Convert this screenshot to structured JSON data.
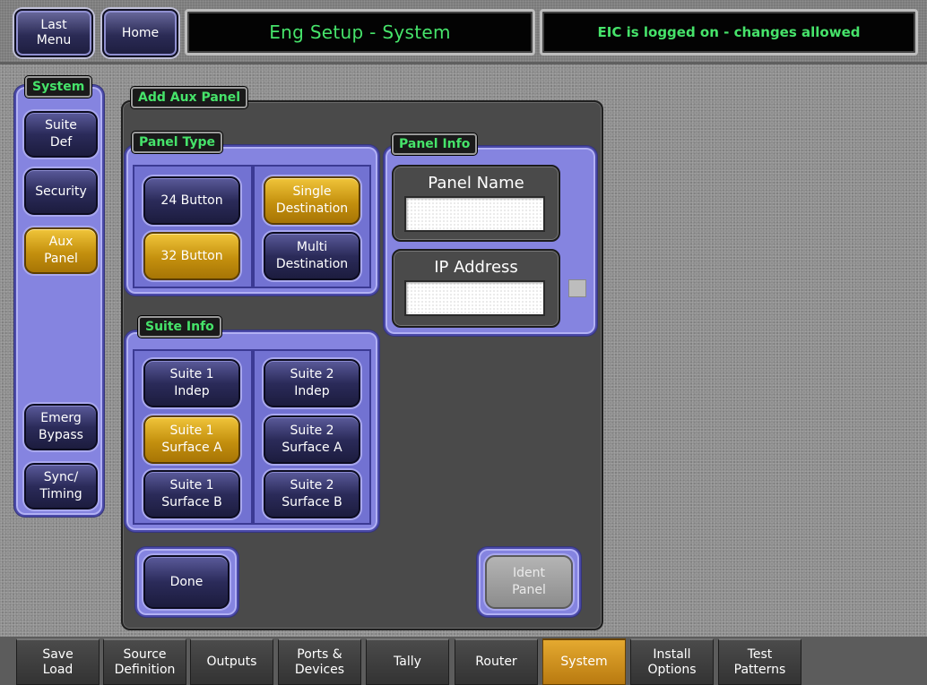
{
  "header": {
    "last_menu_label": "Last\nMenu",
    "home_label": "Home",
    "title": "Eng Setup - System",
    "status": "EIC is logged on - changes allowed"
  },
  "sidebar": {
    "title": "System",
    "items": [
      {
        "label": "Suite\nDef",
        "active": false
      },
      {
        "label": "Security",
        "active": false
      },
      {
        "label": "Aux\nPanel",
        "active": true
      },
      {
        "label": "Emerg\nBypass",
        "active": false
      },
      {
        "label": "Sync/\nTiming",
        "active": false
      }
    ]
  },
  "main": {
    "title": "Add Aux Panel",
    "panel_type": {
      "title": "Panel Type",
      "buttons": [
        {
          "label": "24 Button",
          "active": false
        },
        {
          "label": "Single\nDestination",
          "active": true
        },
        {
          "label": "32 Button",
          "active": true
        },
        {
          "label": "Multi\nDestination",
          "active": false
        }
      ]
    },
    "panel_info": {
      "title": "Panel Info",
      "panel_name_label": "Panel Name",
      "panel_name_value": "",
      "ip_address_label": "IP Address",
      "ip_address_value": ""
    },
    "suite_info": {
      "title": "Suite Info",
      "buttons": [
        {
          "label": "Suite 1\nIndep",
          "active": false
        },
        {
          "label": "Suite 2\nIndep",
          "active": false
        },
        {
          "label": "Suite 1\nSurface A",
          "active": true
        },
        {
          "label": "Suite 2\nSurface A",
          "active": false
        },
        {
          "label": "Suite 1\nSurface B",
          "active": false
        },
        {
          "label": "Suite 2\nSurface B",
          "active": false
        }
      ]
    },
    "done_label": "Done",
    "ident_panel_label": "Ident\nPanel"
  },
  "bottom_tabs": [
    {
      "label": "Save\nLoad",
      "active": false
    },
    {
      "label": "Source\nDefinition",
      "active": false
    },
    {
      "label": "Outputs",
      "active": false
    },
    {
      "label": "Ports &\nDevices",
      "active": false
    },
    {
      "label": "Tally",
      "active": false
    },
    {
      "label": "Router",
      "active": false
    },
    {
      "label": "System",
      "active": true
    },
    {
      "label": "Install\nOptions",
      "active": false
    },
    {
      "label": "Test\nPatterns",
      "active": false
    }
  ],
  "colors": {
    "accent_green": "#46e36a",
    "active_gold": "#c4900e",
    "panel_lavender": "#8584e0"
  }
}
